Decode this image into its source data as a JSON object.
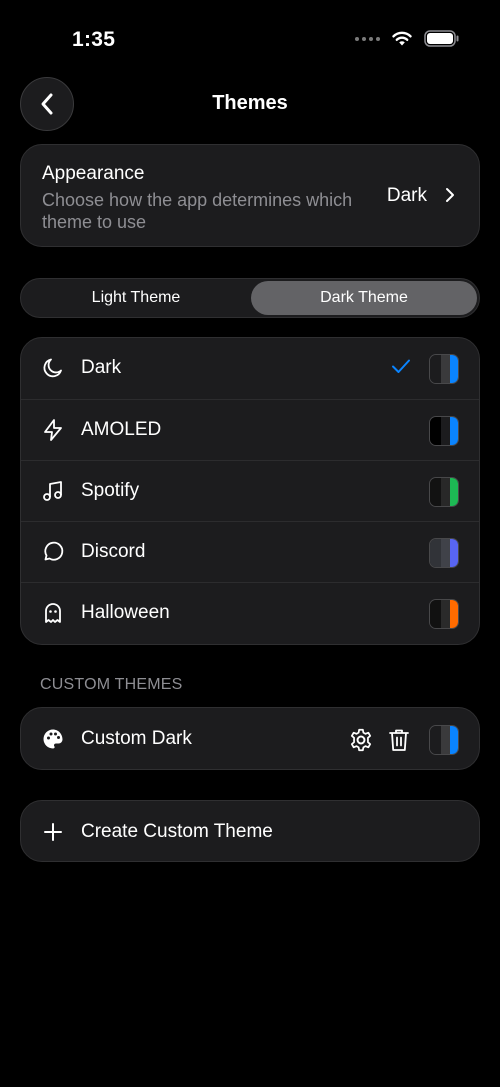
{
  "status_bar": {
    "time": "1:35"
  },
  "header": {
    "title": "Themes"
  },
  "appearance": {
    "title": "Appearance",
    "description": "Choose how the app determines which theme to use",
    "value": "Dark"
  },
  "segmented": {
    "options": [
      "Light Theme",
      "Dark Theme"
    ],
    "selected": "Dark Theme"
  },
  "themes": [
    {
      "label": "Dark",
      "icon": "moon-icon",
      "selected": true,
      "swatch": [
        "#1c1c1e",
        "#3a3a3c",
        "#0a84ff"
      ]
    },
    {
      "label": "AMOLED",
      "icon": "bolt-icon",
      "selected": false,
      "swatch": [
        "#000000",
        "#1c1c1e",
        "#0a84ff"
      ]
    },
    {
      "label": "Spotify",
      "icon": "music-icon",
      "selected": false,
      "swatch": [
        "#121212",
        "#282828",
        "#1db954"
      ]
    },
    {
      "label": "Discord",
      "icon": "chat-icon",
      "selected": false,
      "swatch": [
        "#313338",
        "#404249",
        "#5865f2"
      ]
    },
    {
      "label": "Halloween",
      "icon": "ghost-icon",
      "selected": false,
      "swatch": [
        "#111111",
        "#2a2a2a",
        "#ff6b00"
      ]
    }
  ],
  "custom_section": {
    "header": "CUSTOM THEMES",
    "items": [
      {
        "label": "Custom Dark",
        "icon": "palette-icon",
        "swatch": [
          "#1c1c1e",
          "#3a3a3c",
          "#0a84ff"
        ]
      }
    ]
  },
  "create_button": {
    "label": "Create Custom Theme"
  },
  "colors": {
    "accent": "#0a84ff",
    "background": "#000000",
    "card": "#1c1c1e",
    "secondary_text": "#8e8e93"
  }
}
